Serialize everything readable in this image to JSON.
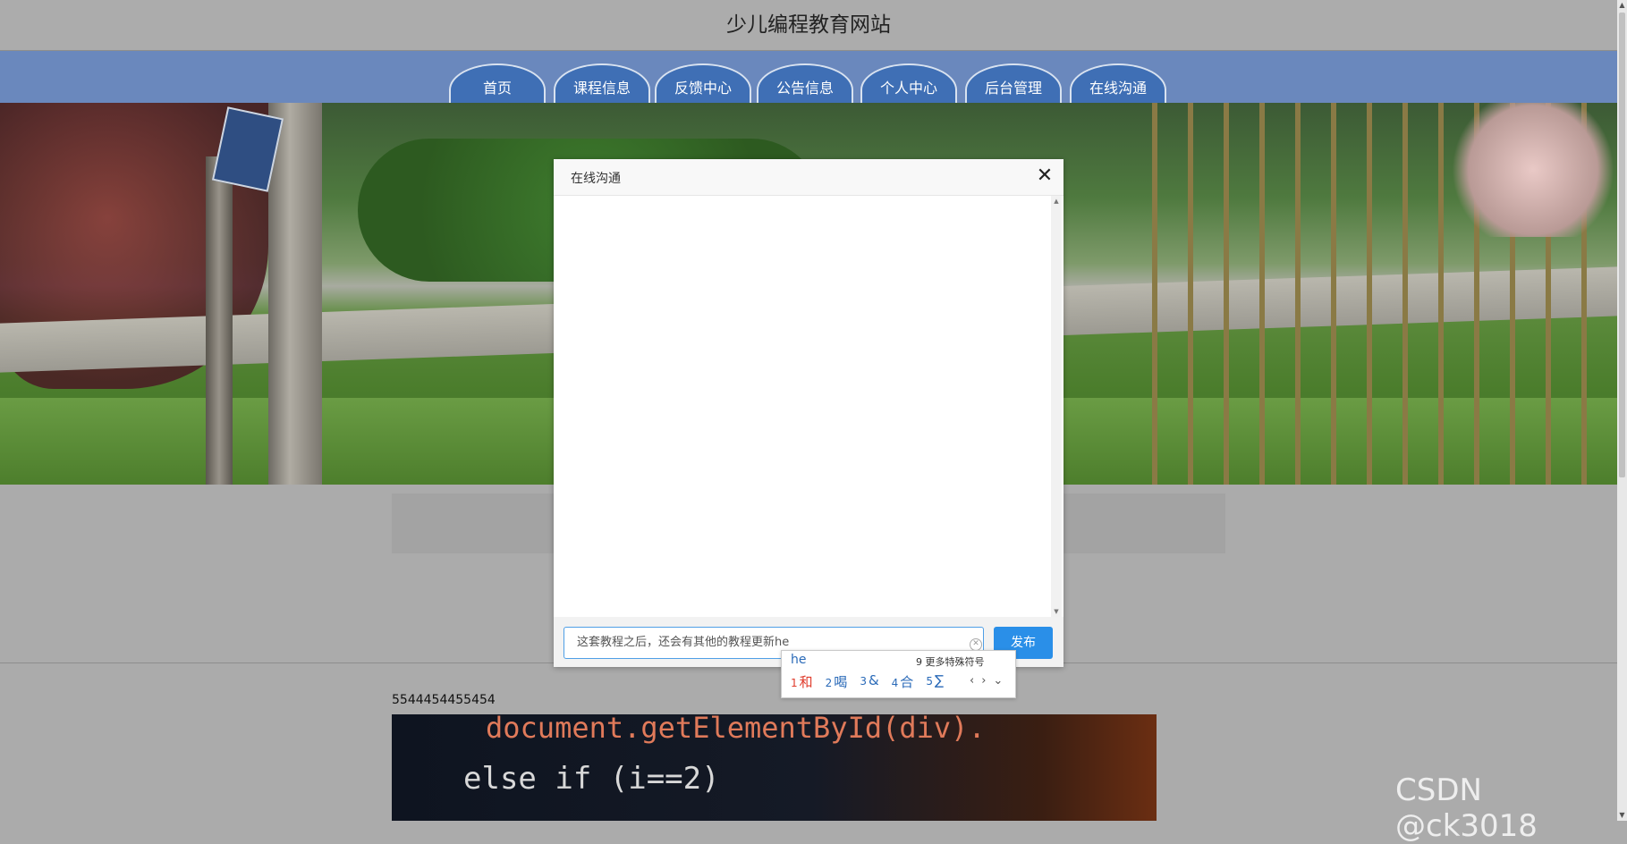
{
  "site": {
    "title": "少儿编程教育网站"
  },
  "nav": {
    "tabs": [
      {
        "label": "首页"
      },
      {
        "label": "课程信息"
      },
      {
        "label": "反馈中心"
      },
      {
        "label": "公告信息"
      },
      {
        "label": "个人中心"
      },
      {
        "label": "后台管理"
      },
      {
        "label": "在线沟通"
      }
    ]
  },
  "content": {
    "number_text": "5544454455454",
    "code_lines": [
      "document.getElementById(div).",
      "else if (i==2)"
    ]
  },
  "modal": {
    "title": "在线沟通",
    "close_glyph": "✕",
    "input_value": "这套教程之后，还会有其他的教程更新he",
    "publish_label": "发布"
  },
  "ime": {
    "composition": "he",
    "more_label": "9 更多特殊符号",
    "candidates": [
      {
        "num": "1",
        "text": "和"
      },
      {
        "num": "2",
        "text": "喝"
      },
      {
        "num": "3",
        "text": "&"
      },
      {
        "num": "4",
        "text": "合"
      },
      {
        "num": "5",
        "text": "∑"
      }
    ],
    "nav_glyphs": {
      "prev": "‹",
      "next": "›",
      "expand": "⌄"
    }
  },
  "watermark": "CSDN @ck3018",
  "colors": {
    "nav_bar": "#6a88bd",
    "nav_tab": "#3f6fb5",
    "publish_button": "#2a8fe8",
    "input_border": "#4f9fe6",
    "ime_first": "#e03b2b"
  },
  "icons": {
    "close": "close-icon",
    "clear": "clear-input-icon",
    "scroll_up": "scroll-up-arrow-icon",
    "scroll_down": "scroll-down-arrow-icon"
  }
}
